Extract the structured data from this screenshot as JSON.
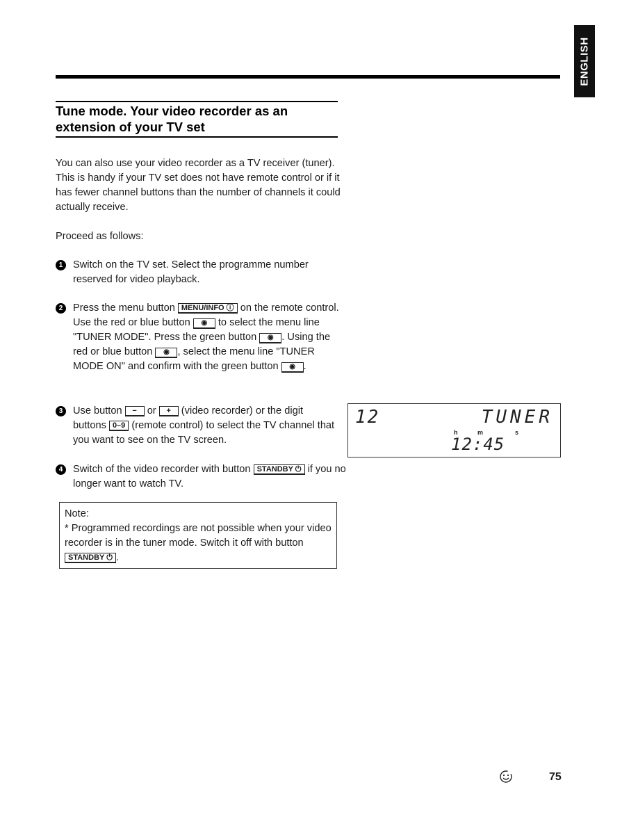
{
  "language_tab": "ENGLISH",
  "section": {
    "title": "Tune mode. Your video recorder as an extension of your TV set"
  },
  "intro": "You can also use your video recorder as a TV receiver (tuner). This is handy if your TV set does not have remote control or if it has fewer channel buttons than the number of channels it could actually receive.",
  "proceed": "Proceed as follows:",
  "steps": [
    {
      "num": "1",
      "parts": [
        "Switch on the TV set. Select the programme number reserved for video playback."
      ]
    },
    {
      "num": "2",
      "parts": [
        "Press the menu button ",
        "MENU/INFO ⓘ",
        " on the remote control. Use the red or blue button ",
        "◉",
        " to select the menu line \"TUNER MODE\".  Press the green button ",
        "◉",
        ". Using the red or blue button ",
        "◉",
        ", select the menu line \"TUNER MODE ON\" and confirm with the green button ",
        "◉",
        "."
      ]
    },
    {
      "num": "3",
      "parts": [
        "Use button ",
        "−",
        " or ",
        "+",
        " (video recorder) or the digit buttons ",
        "0–9",
        " (remote control) to select the TV channel that you want to see on the TV screen."
      ]
    },
    {
      "num": "4",
      "parts": [
        "Switch of the video recorder with button ",
        "STANDBY ⏻",
        " if you no longer want to watch TV."
      ]
    }
  ],
  "note": {
    "heading": "Note:",
    "text": "* Programmed recordings are not possible when your video recorder is in the tuner mode. Switch it off with button ",
    "key": "STANDBY ⏻",
    "end": "."
  },
  "display": {
    "channel": "12",
    "mode": "TUNER",
    "units": [
      "h",
      "m",
      "s"
    ],
    "clock": "12:45"
  },
  "footer": {
    "icon": "smiley-tip-icon",
    "page_number": "75"
  }
}
